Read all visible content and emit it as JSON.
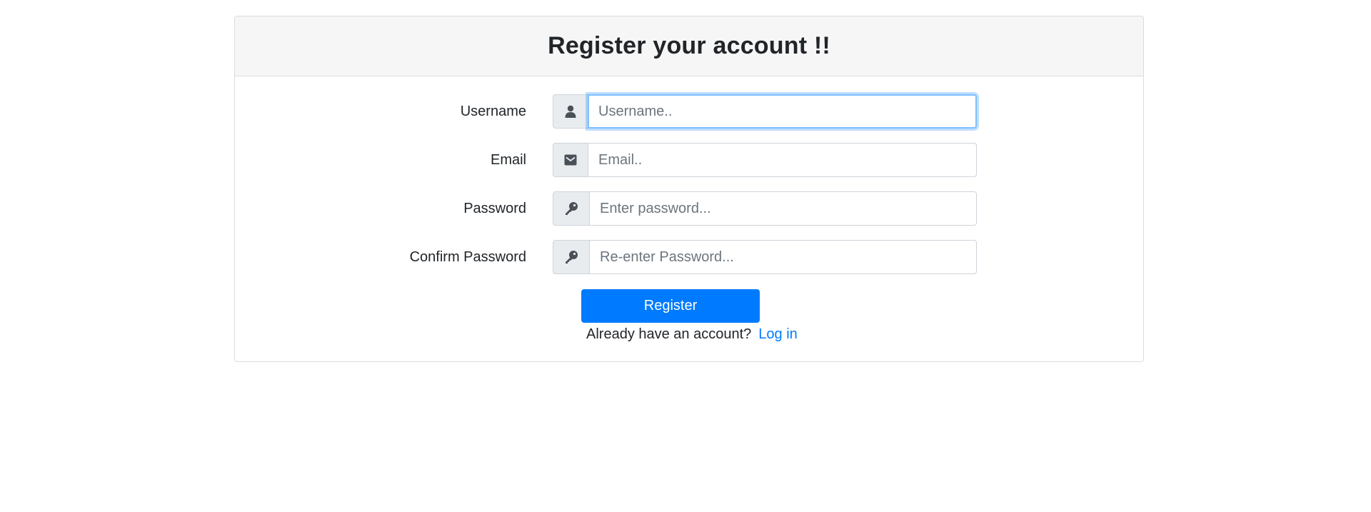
{
  "header": {
    "title": "Register your account !!"
  },
  "form": {
    "username": {
      "label": "Username",
      "placeholder": "Username..",
      "value": "",
      "icon": "user-icon"
    },
    "email": {
      "label": "Email",
      "placeholder": "Email..",
      "value": "",
      "icon": "envelope-icon"
    },
    "password": {
      "label": "Password",
      "placeholder": "Enter password...",
      "value": "",
      "icon": "key-icon"
    },
    "confirm_password": {
      "label": "Confirm Password",
      "placeholder": "Re-enter Password...",
      "value": "",
      "icon": "key-icon"
    },
    "register_label": "Register",
    "login_prompt": "Already have an account?",
    "login_link": "Log in"
  },
  "colors": {
    "primary": "#007bff",
    "header_bg": "#f6f6f6",
    "addon_bg": "#e9ecef",
    "icon": "#495057",
    "focus_border": "#80bdff"
  }
}
